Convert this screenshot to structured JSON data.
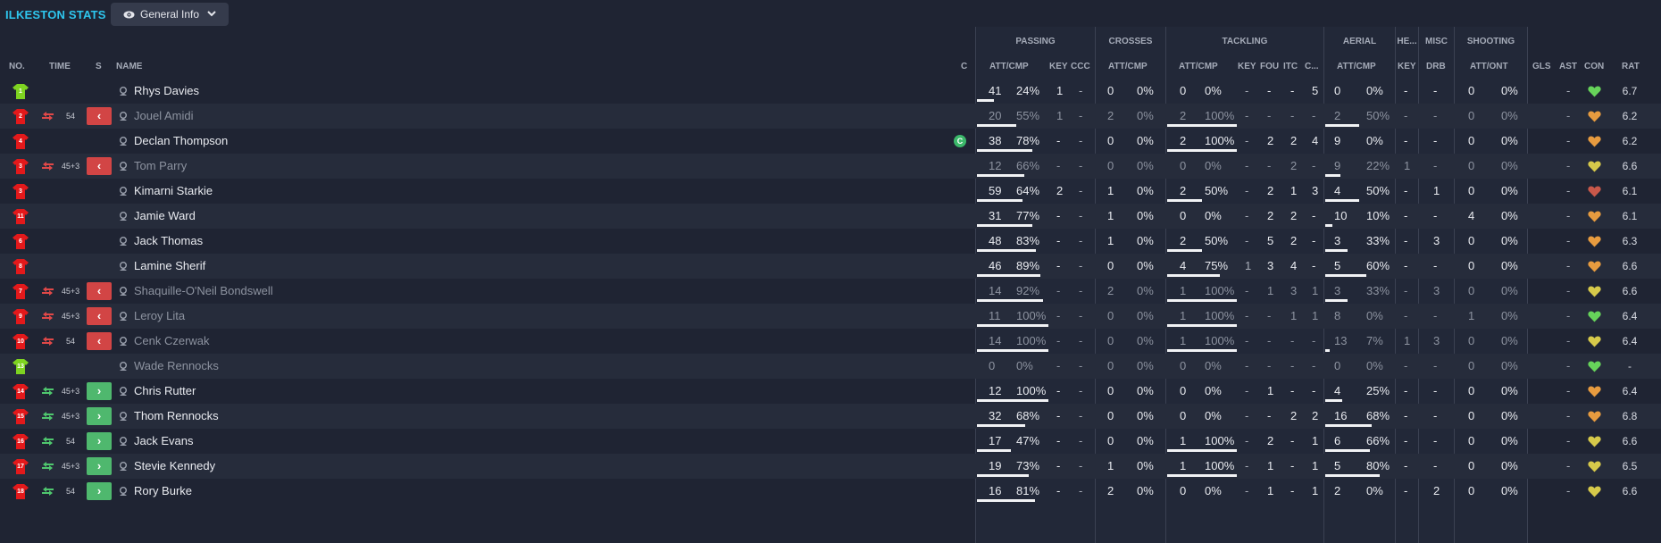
{
  "team_title": "ILKESTON STATS",
  "view_button": {
    "label": "General Info",
    "icon": "eye-icon",
    "chevron": "chevron-down-icon"
  },
  "colors": {
    "accent": "#2ec6ee",
    "sub_off": "#d24545",
    "sub_on": "#4fb86e",
    "keeper_shirt": "#7ed321",
    "outfield_shirt": "#e3191b"
  },
  "headers": {
    "no": "NO.",
    "time": "TIME",
    "s": "S",
    "name": "NAME",
    "c": "C",
    "groups": {
      "passing": "PASSING",
      "crosses": "CROSSES",
      "tackling": "TACKLING",
      "aerial": "AERIAL",
      "headers": "HE...",
      "misc": "MISC",
      "shooting": "SHOOTING"
    },
    "sub": {
      "att_cmp": "ATT/CMP",
      "key": "KEY",
      "ccc": "CCC",
      "fou": "FOU",
      "itc": "ITC",
      "c_trunc": "C...",
      "drb": "DRB",
      "att_ont": "ATT/ONT",
      "gls": "GLS",
      "ast": "AST",
      "con": "CON",
      "rat": "RAT"
    }
  },
  "players": [
    {
      "no": "1",
      "shirt": "keeper",
      "time": "",
      "sub": "",
      "name": "Rhys Davies",
      "captain": false,
      "faded": false,
      "pass_att": "41",
      "pass_pct": "24%",
      "pass_frac": 0.24,
      "key": "1",
      "ccc": "-",
      "cross_att": "0",
      "cross_pct": "0%",
      "cross_frac": 0,
      "tack_att": "0",
      "tack_pct": "0%",
      "tack_frac": 0,
      "t_key": "-",
      "fou": "-",
      "itc": "-",
      "c": "5",
      "aer_att": "0",
      "aer_pct": "0%",
      "aer_frac": 0,
      "head_key": "-",
      "drb": "-",
      "shot_att": "0",
      "shot_pct": "0%",
      "shot_frac": 0,
      "gls": "",
      "ast": "-",
      "con": "green",
      "rat": "6.7"
    },
    {
      "no": "2",
      "shirt": "outfield",
      "time": "54",
      "sub": "off",
      "name": "Jouel Amidi",
      "captain": false,
      "faded": true,
      "pass_att": "20",
      "pass_pct": "55%",
      "pass_frac": 0.55,
      "key": "1",
      "ccc": "-",
      "cross_att": "2",
      "cross_pct": "0%",
      "cross_frac": 0,
      "tack_att": "2",
      "tack_pct": "100%",
      "tack_frac": 1,
      "t_key": "-",
      "fou": "-",
      "itc": "-",
      "c": "-",
      "aer_att": "2",
      "aer_pct": "50%",
      "aer_frac": 0.5,
      "head_key": "-",
      "drb": "-",
      "shot_att": "0",
      "shot_pct": "0%",
      "shot_frac": 0,
      "gls": "",
      "ast": "-",
      "con": "orange",
      "rat": "6.2"
    },
    {
      "no": "4",
      "shirt": "outfield",
      "time": "",
      "sub": "",
      "name": "Declan Thompson",
      "captain": true,
      "faded": false,
      "pass_att": "38",
      "pass_pct": "78%",
      "pass_frac": 0.78,
      "key": "-",
      "ccc": "-",
      "cross_att": "0",
      "cross_pct": "0%",
      "cross_frac": 0,
      "tack_att": "2",
      "tack_pct": "100%",
      "tack_frac": 1,
      "t_key": "-",
      "fou": "2",
      "itc": "2",
      "c": "4",
      "aer_att": "9",
      "aer_pct": "0%",
      "aer_frac": 0,
      "head_key": "-",
      "drb": "-",
      "shot_att": "0",
      "shot_pct": "0%",
      "shot_frac": 0,
      "gls": "",
      "ast": "-",
      "con": "orange",
      "rat": "6.2"
    },
    {
      "no": "3",
      "shirt": "outfield",
      "time": "45+3",
      "sub": "off",
      "name": "Tom Parry",
      "captain": false,
      "faded": true,
      "pass_att": "12",
      "pass_pct": "66%",
      "pass_frac": 0.66,
      "key": "-",
      "ccc": "-",
      "cross_att": "0",
      "cross_pct": "0%",
      "cross_frac": 0,
      "tack_att": "0",
      "tack_pct": "0%",
      "tack_frac": 0,
      "t_key": "-",
      "fou": "-",
      "itc": "2",
      "c": "-",
      "aer_att": "9",
      "aer_pct": "22%",
      "aer_frac": 0.22,
      "head_key": "1",
      "drb": "-",
      "shot_att": "0",
      "shot_pct": "0%",
      "shot_frac": 0,
      "gls": "",
      "ast": "-",
      "con": "yellow",
      "rat": "6.6"
    },
    {
      "no": "3",
      "shirt": "outfield",
      "time": "",
      "sub": "",
      "name": "Kimarni Starkie",
      "captain": false,
      "faded": false,
      "pass_att": "59",
      "pass_pct": "64%",
      "pass_frac": 0.64,
      "key": "2",
      "ccc": "-",
      "cross_att": "1",
      "cross_pct": "0%",
      "cross_frac": 0,
      "tack_att": "2",
      "tack_pct": "50%",
      "tack_frac": 0.5,
      "t_key": "-",
      "fou": "2",
      "itc": "1",
      "c": "3",
      "aer_att": "4",
      "aer_pct": "50%",
      "aer_frac": 0.5,
      "head_key": "-",
      "drb": "1",
      "shot_att": "0",
      "shot_pct": "0%",
      "shot_frac": 0,
      "gls": "",
      "ast": "-",
      "con": "red",
      "rat": "6.1"
    },
    {
      "no": "11",
      "shirt": "outfield",
      "time": "",
      "sub": "",
      "name": "Jamie Ward",
      "captain": false,
      "faded": false,
      "pass_att": "31",
      "pass_pct": "77%",
      "pass_frac": 0.77,
      "key": "-",
      "ccc": "-",
      "cross_att": "1",
      "cross_pct": "0%",
      "cross_frac": 0,
      "tack_att": "0",
      "tack_pct": "0%",
      "tack_frac": 0,
      "t_key": "-",
      "fou": "2",
      "itc": "2",
      "c": "-",
      "aer_att": "10",
      "aer_pct": "10%",
      "aer_frac": 0.1,
      "head_key": "-",
      "drb": "-",
      "shot_att": "4",
      "shot_pct": "0%",
      "shot_frac": 0,
      "gls": "",
      "ast": "-",
      "con": "orange",
      "rat": "6.1"
    },
    {
      "no": "6",
      "shirt": "outfield",
      "time": "",
      "sub": "",
      "name": "Jack Thomas",
      "captain": false,
      "faded": false,
      "pass_att": "48",
      "pass_pct": "83%",
      "pass_frac": 0.83,
      "key": "-",
      "ccc": "-",
      "cross_att": "1",
      "cross_pct": "0%",
      "cross_frac": 0,
      "tack_att": "2",
      "tack_pct": "50%",
      "tack_frac": 0.5,
      "t_key": "-",
      "fou": "5",
      "itc": "2",
      "c": "-",
      "aer_att": "3",
      "aer_pct": "33%",
      "aer_frac": 0.33,
      "head_key": "-",
      "drb": "3",
      "shot_att": "0",
      "shot_pct": "0%",
      "shot_frac": 0,
      "gls": "",
      "ast": "-",
      "con": "orange",
      "rat": "6.3"
    },
    {
      "no": "8",
      "shirt": "outfield",
      "time": "",
      "sub": "",
      "name": "Lamine Sherif",
      "captain": false,
      "faded": false,
      "pass_att": "46",
      "pass_pct": "89%",
      "pass_frac": 0.89,
      "key": "-",
      "ccc": "-",
      "cross_att": "0",
      "cross_pct": "0%",
      "cross_frac": 0,
      "tack_att": "4",
      "tack_pct": "75%",
      "tack_frac": 0.75,
      "t_key": "1",
      "fou": "3",
      "itc": "4",
      "c": "-",
      "aer_att": "5",
      "aer_pct": "60%",
      "aer_frac": 0.6,
      "head_key": "-",
      "drb": "-",
      "shot_att": "0",
      "shot_pct": "0%",
      "shot_frac": 0,
      "gls": "",
      "ast": "-",
      "con": "orange",
      "rat": "6.6"
    },
    {
      "no": "7",
      "shirt": "outfield",
      "time": "45+3",
      "sub": "off",
      "name": "Shaquille-O'Neil Bondswell",
      "captain": false,
      "faded": true,
      "pass_att": "14",
      "pass_pct": "92%",
      "pass_frac": 0.92,
      "key": "-",
      "ccc": "-",
      "cross_att": "2",
      "cross_pct": "0%",
      "cross_frac": 0,
      "tack_att": "1",
      "tack_pct": "100%",
      "tack_frac": 1,
      "t_key": "-",
      "fou": "1",
      "itc": "3",
      "c": "1",
      "aer_att": "3",
      "aer_pct": "33%",
      "aer_frac": 0.33,
      "head_key": "-",
      "drb": "3",
      "shot_att": "0",
      "shot_pct": "0%",
      "shot_frac": 0,
      "gls": "",
      "ast": "-",
      "con": "yellow",
      "rat": "6.6"
    },
    {
      "no": "9",
      "shirt": "outfield",
      "time": "45+3",
      "sub": "off",
      "name": "Leroy Lita",
      "captain": false,
      "faded": true,
      "pass_att": "11",
      "pass_pct": "100%",
      "pass_frac": 1,
      "key": "-",
      "ccc": "-",
      "cross_att": "0",
      "cross_pct": "0%",
      "cross_frac": 0,
      "tack_att": "1",
      "tack_pct": "100%",
      "tack_frac": 1,
      "t_key": "-",
      "fou": "-",
      "itc": "1",
      "c": "1",
      "aer_att": "8",
      "aer_pct": "0%",
      "aer_frac": 0,
      "head_key": "-",
      "drb": "-",
      "shot_att": "1",
      "shot_pct": "0%",
      "shot_frac": 0,
      "gls": "",
      "ast": "-",
      "con": "green",
      "rat": "6.4"
    },
    {
      "no": "10",
      "shirt": "outfield",
      "time": "54",
      "sub": "off",
      "name": "Cenk Czerwak",
      "captain": false,
      "faded": true,
      "pass_att": "14",
      "pass_pct": "100%",
      "pass_frac": 1,
      "key": "-",
      "ccc": "-",
      "cross_att": "0",
      "cross_pct": "0%",
      "cross_frac": 0,
      "tack_att": "1",
      "tack_pct": "100%",
      "tack_frac": 1,
      "t_key": "-",
      "fou": "-",
      "itc": "-",
      "c": "-",
      "aer_att": "13",
      "aer_pct": "7%",
      "aer_frac": 0.07,
      "head_key": "1",
      "drb": "3",
      "shot_att": "0",
      "shot_pct": "0%",
      "shot_frac": 0,
      "gls": "",
      "ast": "-",
      "con": "yellow",
      "rat": "6.4"
    },
    {
      "no": "13",
      "shirt": "keeper",
      "time": "",
      "sub": "",
      "name": "Wade Rennocks",
      "captain": false,
      "faded": true,
      "pass_att": "0",
      "pass_pct": "0%",
      "pass_frac": 0,
      "key": "-",
      "ccc": "-",
      "cross_att": "0",
      "cross_pct": "0%",
      "cross_frac": 0,
      "tack_att": "0",
      "tack_pct": "0%",
      "tack_frac": 0,
      "t_key": "-",
      "fou": "-",
      "itc": "-",
      "c": "-",
      "aer_att": "0",
      "aer_pct": "0%",
      "aer_frac": 0,
      "head_key": "-",
      "drb": "-",
      "shot_att": "0",
      "shot_pct": "0%",
      "shot_frac": 0,
      "gls": "",
      "ast": "-",
      "con": "green",
      "rat": "-"
    },
    {
      "no": "14",
      "shirt": "outfield",
      "time": "45+3",
      "sub": "on",
      "name": "Chris Rutter",
      "captain": false,
      "faded": false,
      "pass_att": "12",
      "pass_pct": "100%",
      "pass_frac": 1,
      "key": "-",
      "ccc": "-",
      "cross_att": "0",
      "cross_pct": "0%",
      "cross_frac": 0,
      "tack_att": "0",
      "tack_pct": "0%",
      "tack_frac": 0,
      "t_key": "-",
      "fou": "1",
      "itc": "-",
      "c": "-",
      "aer_att": "4",
      "aer_pct": "25%",
      "aer_frac": 0.25,
      "head_key": "-",
      "drb": "-",
      "shot_att": "0",
      "shot_pct": "0%",
      "shot_frac": 0,
      "gls": "",
      "ast": "-",
      "con": "orange",
      "rat": "6.4"
    },
    {
      "no": "15",
      "shirt": "outfield",
      "time": "45+3",
      "sub": "on",
      "name": "Thom Rennocks",
      "captain": false,
      "faded": false,
      "pass_att": "32",
      "pass_pct": "68%",
      "pass_frac": 0.68,
      "key": "-",
      "ccc": "-",
      "cross_att": "0",
      "cross_pct": "0%",
      "cross_frac": 0,
      "tack_att": "0",
      "tack_pct": "0%",
      "tack_frac": 0,
      "t_key": "-",
      "fou": "-",
      "itc": "2",
      "c": "2",
      "aer_att": "16",
      "aer_pct": "68%",
      "aer_frac": 0.68,
      "head_key": "-",
      "drb": "-",
      "shot_att": "0",
      "shot_pct": "0%",
      "shot_frac": 0,
      "gls": "",
      "ast": "-",
      "con": "orange",
      "rat": "6.8"
    },
    {
      "no": "16",
      "shirt": "outfield",
      "time": "54",
      "sub": "on",
      "name": "Jack Evans",
      "captain": false,
      "faded": false,
      "pass_att": "17",
      "pass_pct": "47%",
      "pass_frac": 0.47,
      "key": "-",
      "ccc": "-",
      "cross_att": "0",
      "cross_pct": "0%",
      "cross_frac": 0,
      "tack_att": "1",
      "tack_pct": "100%",
      "tack_frac": 1,
      "t_key": "-",
      "fou": "2",
      "itc": "-",
      "c": "1",
      "aer_att": "6",
      "aer_pct": "66%",
      "aer_frac": 0.66,
      "head_key": "-",
      "drb": "-",
      "shot_att": "0",
      "shot_pct": "0%",
      "shot_frac": 0,
      "gls": "",
      "ast": "-",
      "con": "yellow",
      "rat": "6.6"
    },
    {
      "no": "17",
      "shirt": "outfield",
      "time": "45+3",
      "sub": "on",
      "name": "Stevie Kennedy",
      "captain": false,
      "faded": false,
      "pass_att": "19",
      "pass_pct": "73%",
      "pass_frac": 0.73,
      "key": "-",
      "ccc": "-",
      "cross_att": "1",
      "cross_pct": "0%",
      "cross_frac": 0,
      "tack_att": "1",
      "tack_pct": "100%",
      "tack_frac": 1,
      "t_key": "-",
      "fou": "1",
      "itc": "-",
      "c": "1",
      "aer_att": "5",
      "aer_pct": "80%",
      "aer_frac": 0.8,
      "head_key": "-",
      "drb": "-",
      "shot_att": "0",
      "shot_pct": "0%",
      "shot_frac": 0,
      "gls": "",
      "ast": "-",
      "con": "yellow",
      "rat": "6.5"
    },
    {
      "no": "18",
      "shirt": "outfield",
      "time": "54",
      "sub": "on",
      "name": "Rory Burke",
      "captain": false,
      "faded": false,
      "pass_att": "16",
      "pass_pct": "81%",
      "pass_frac": 0.81,
      "key": "-",
      "ccc": "-",
      "cross_att": "2",
      "cross_pct": "0%",
      "cross_frac": 0,
      "tack_att": "0",
      "tack_pct": "0%",
      "tack_frac": 0,
      "t_key": "-",
      "fou": "1",
      "itc": "-",
      "c": "1",
      "aer_att": "2",
      "aer_pct": "0%",
      "aer_frac": 0,
      "head_key": "-",
      "drb": "2",
      "shot_att": "0",
      "shot_pct": "0%",
      "shot_frac": 0,
      "gls": "",
      "ast": "-",
      "con": "yellow",
      "rat": "6.6"
    }
  ]
}
